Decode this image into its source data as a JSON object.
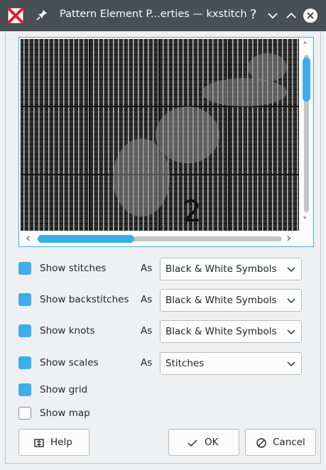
{
  "window": {
    "title": "Pattern Element P...erties — kxstitch",
    "help_glyph": "?",
    "app_icon": "kxstitch-app-icon",
    "pin_icon": "pin-icon"
  },
  "preview": {
    "overlay_digit": "2",
    "scroll_left": "‹",
    "scroll_right": "›",
    "scroll_up": "˄",
    "scroll_down": "˅"
  },
  "options": [
    {
      "label": "Show stitches",
      "checked": true,
      "as_label": "As",
      "value": "Black & White Symbols"
    },
    {
      "label": "Show backstitches",
      "checked": true,
      "as_label": "As",
      "value": "Black & White Symbols"
    },
    {
      "label": "Show knots",
      "checked": true,
      "as_label": "As",
      "value": "Black & White Symbols"
    },
    {
      "label": "Show scales",
      "checked": true,
      "as_label": "As",
      "value": "Stitches"
    }
  ],
  "grid": {
    "label": "Show grid",
    "checked": true
  },
  "map": {
    "label": "Show map",
    "checked": false
  },
  "buttons": {
    "help": "Help",
    "ok": "OK",
    "cancel": "Cancel"
  },
  "colors": {
    "titlebar": "#475057",
    "accent": "#3daee9",
    "background": "#eff0f1"
  }
}
